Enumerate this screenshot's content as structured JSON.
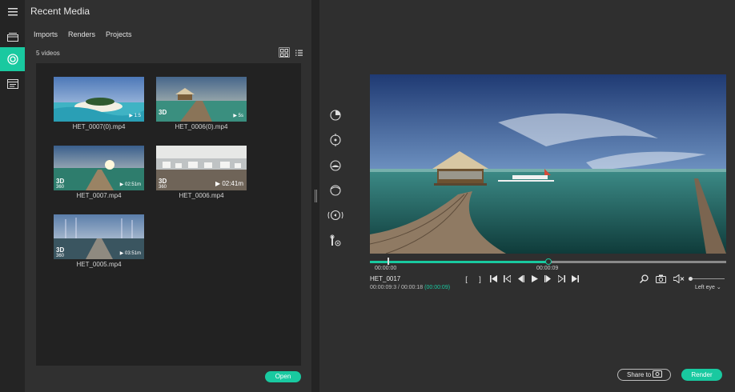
{
  "colors": {
    "accent": "#19c9a0",
    "panel": "#303030",
    "rail": "#242424",
    "grid": "#222222"
  },
  "rail": {
    "items": [
      {
        "icon": "menu-icon"
      },
      {
        "icon": "media-library-icon"
      },
      {
        "icon": "360-media-icon",
        "active": true
      },
      {
        "icon": "editor-icon"
      }
    ]
  },
  "panel": {
    "title": "Recent Media",
    "tabs": [
      "Imports",
      "Renders",
      "Projects"
    ],
    "count": "5 videos",
    "open_label": "Open"
  },
  "media": [
    {
      "name": "HET_0007(0).mp4",
      "badge3d": "",
      "badge360": "",
      "duration": "1:5"
    },
    {
      "name": "HET_0006(0).mp4",
      "badge3d": "3D",
      "badge360": "",
      "duration": "5s"
    },
    {
      "name": "HET_0007.mp4",
      "badge3d": "3D",
      "badge360": "360",
      "duration": "02:51m"
    },
    {
      "name": "HET_0006.mp4",
      "badge3d": "3D",
      "badge360": "360",
      "duration": "02:41m"
    },
    {
      "name": "HET_0005.mp4",
      "badge3d": "3D",
      "badge360": "360",
      "duration": "03:51m"
    }
  ],
  "player": {
    "clip_name": "HET_0017",
    "time_current": "00:00:09:3",
    "time_total": "00:00:18",
    "time_highlight": "(00:00:09)",
    "timeline_start": "00:00:00",
    "timeline_playhead": "00:00:09",
    "progress": 0.5,
    "eye_label": "Left eye",
    "share_label": "Share to",
    "render_label": "Render"
  },
  "tools": [
    "little-planet-icon",
    "crosshair-icon",
    "sphere-icon",
    "rotate-icon",
    "orientation-icon",
    "settings-tool-icon"
  ]
}
